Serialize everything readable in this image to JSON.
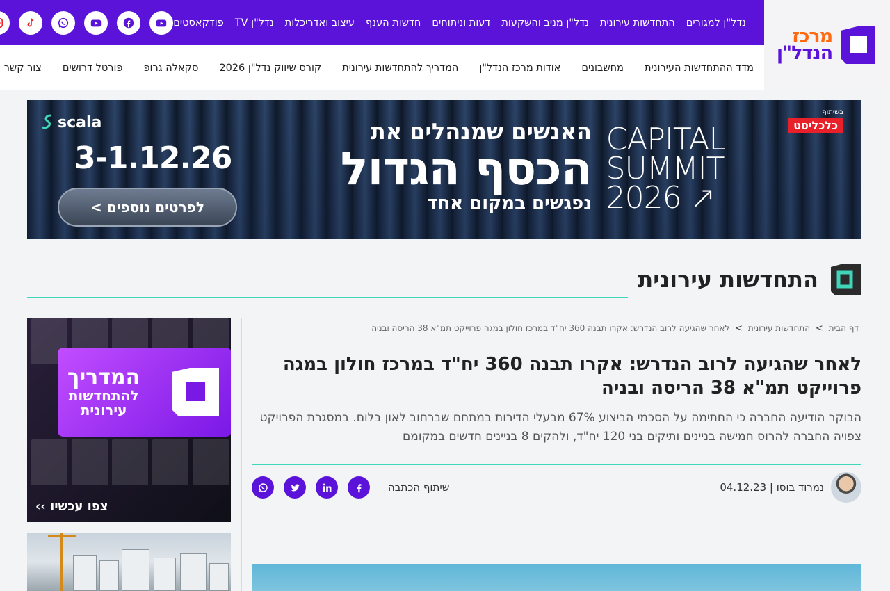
{
  "logo": {
    "line1": "מרכז",
    "line2": "הנדל\"ן"
  },
  "top_menu": [
    {
      "label": "נדל\"ן למגורים"
    },
    {
      "label": "התחדשות עירונית"
    },
    {
      "label": "נדל\"ן מניב והשקעות"
    },
    {
      "label": "דעות וניתוחים"
    },
    {
      "label": "חדשות הענף"
    },
    {
      "label": "עיצוב ואדריכלות"
    },
    {
      "label": "נדל\"ן TV"
    },
    {
      "label": "פודקאסטים"
    }
  ],
  "social": [
    "youtube-icon",
    "facebook-icon",
    "youtube-icon",
    "whatsapp-icon",
    "tiktok-icon",
    "instagram-icon"
  ],
  "main_nav": [
    {
      "label": "מדד ההתחדשות העירונית"
    },
    {
      "label": "מחשבונים"
    },
    {
      "label": "אודות מרכז הנדל\"ן"
    },
    {
      "label": "המדריך להתחדשות עירונית"
    },
    {
      "label": "קורס שיווק נדל\"ן 2026"
    },
    {
      "label": "סקאלה גרופ"
    },
    {
      "label": "פורטל דרושים"
    },
    {
      "label": "צור קשר"
    }
  ],
  "banner": {
    "partner_small": "בשיתוף",
    "partner_brand": "כלכליסט",
    "capital_l1": "CAPITAL",
    "capital_l2": "SUMMIT",
    "capital_l3": "2026",
    "headline_1": "האנשים שמנהלים את",
    "headline_2": "הכסף הגדול",
    "headline_3": "נפגשים במקום אחד",
    "scala": "scala",
    "date": "3-1.12.26",
    "cta": "לפרטים נוספים >"
  },
  "section": {
    "title": "התחדשות עירונית"
  },
  "sidebar_ad": {
    "line1": "המדריך",
    "line2": "להתחדשות",
    "line3": "עירונית",
    "cta": "צפו עכשיו ››"
  },
  "article": {
    "breadcrumb": {
      "home": "דף הבית",
      "category": "התחדשות עירונית",
      "current": "לאחר שהגיעה לרוב הנדרש: אקרו תבנה 360 יח\"ד במרכז חולון במגה פרוייקט תמ\"א 38 הריסה ובניה"
    },
    "title": "לאחר שהגיעה לרוב הנדרש: אקרו תבנה 360 יח\"ד במרכז חולון במגה פרוייקט תמ\"א 38 הריסה ובניה",
    "lead": "הבוקר הודיעה החברה כי החתימה על הסכמי הביצוע 67% מבעלי הדירות במתחם שברחוב לאון בלום. במסגרת הפרויקט צפויה החברה להרוס חמישה בניינים ותיקים בני 120 יח\"ד, ולהקים 8 בניינים חדשים במקומם",
    "author_line": "נמרוד בוסו | 04.12.23",
    "share_label": "שיתוף הכתבה",
    "share_icons": [
      "facebook-icon",
      "linkedin-icon",
      "twitter-icon",
      "whatsapp-icon"
    ]
  },
  "colors": {
    "brand_purple": "#5b13d9",
    "accent_teal": "#3fd6b9",
    "logo_orange": "#ff6a10"
  }
}
